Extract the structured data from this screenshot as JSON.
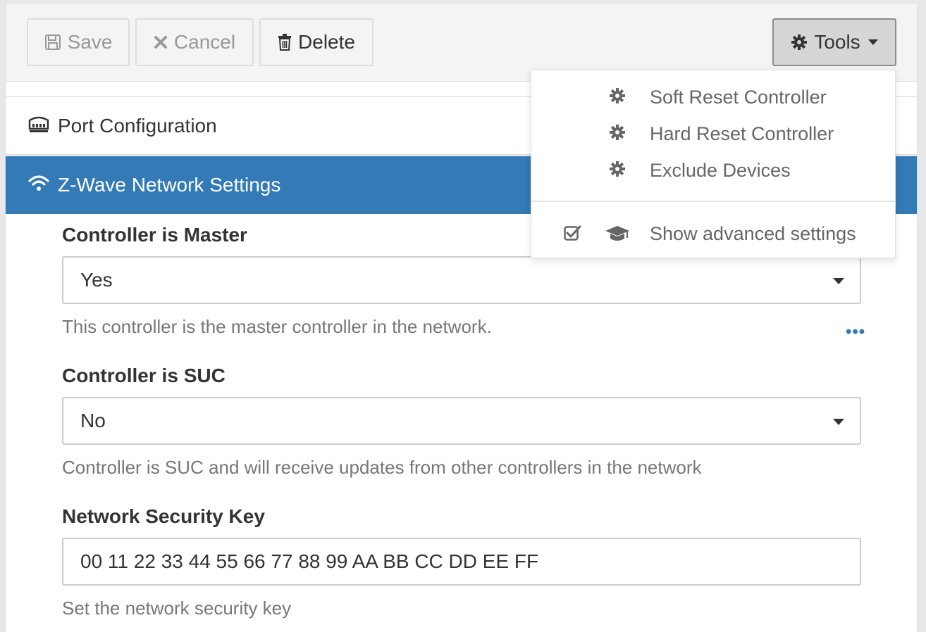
{
  "toolbar": {
    "save_label": "Save",
    "cancel_label": "Cancel",
    "delete_label": "Delete",
    "tools_label": "Tools"
  },
  "tabs": {
    "port": {
      "label": "Port Configuration",
      "icon": "ethernet-port-icon"
    },
    "zwave": {
      "label": "Z-Wave Network Settings",
      "icon": "wifi-icon",
      "active_color": "#337ab7"
    }
  },
  "fields": {
    "master": {
      "label": "Controller is Master",
      "value": "Yes",
      "help": "This controller is the master controller in the network."
    },
    "suc": {
      "label": "Controller is SUC",
      "value": "No",
      "help": "Controller is SUC and will receive updates from other controllers in the network"
    },
    "key": {
      "label": "Network Security Key",
      "value": "00 11 22 33 44 55 66 77 88 99 AA BB CC DD EE FF",
      "help": "Set the network security key"
    }
  },
  "tools_menu": {
    "items": [
      {
        "label": "Soft Reset Controller",
        "icon": "gear-icon"
      },
      {
        "label": "Hard Reset Controller",
        "icon": "gear-icon"
      },
      {
        "label": "Exclude Devices",
        "icon": "gear-icon"
      }
    ],
    "advanced": {
      "label": "Show advanced settings",
      "icon": "graduation-cap-icon",
      "checked": true
    }
  },
  "more_indicator": "•••"
}
